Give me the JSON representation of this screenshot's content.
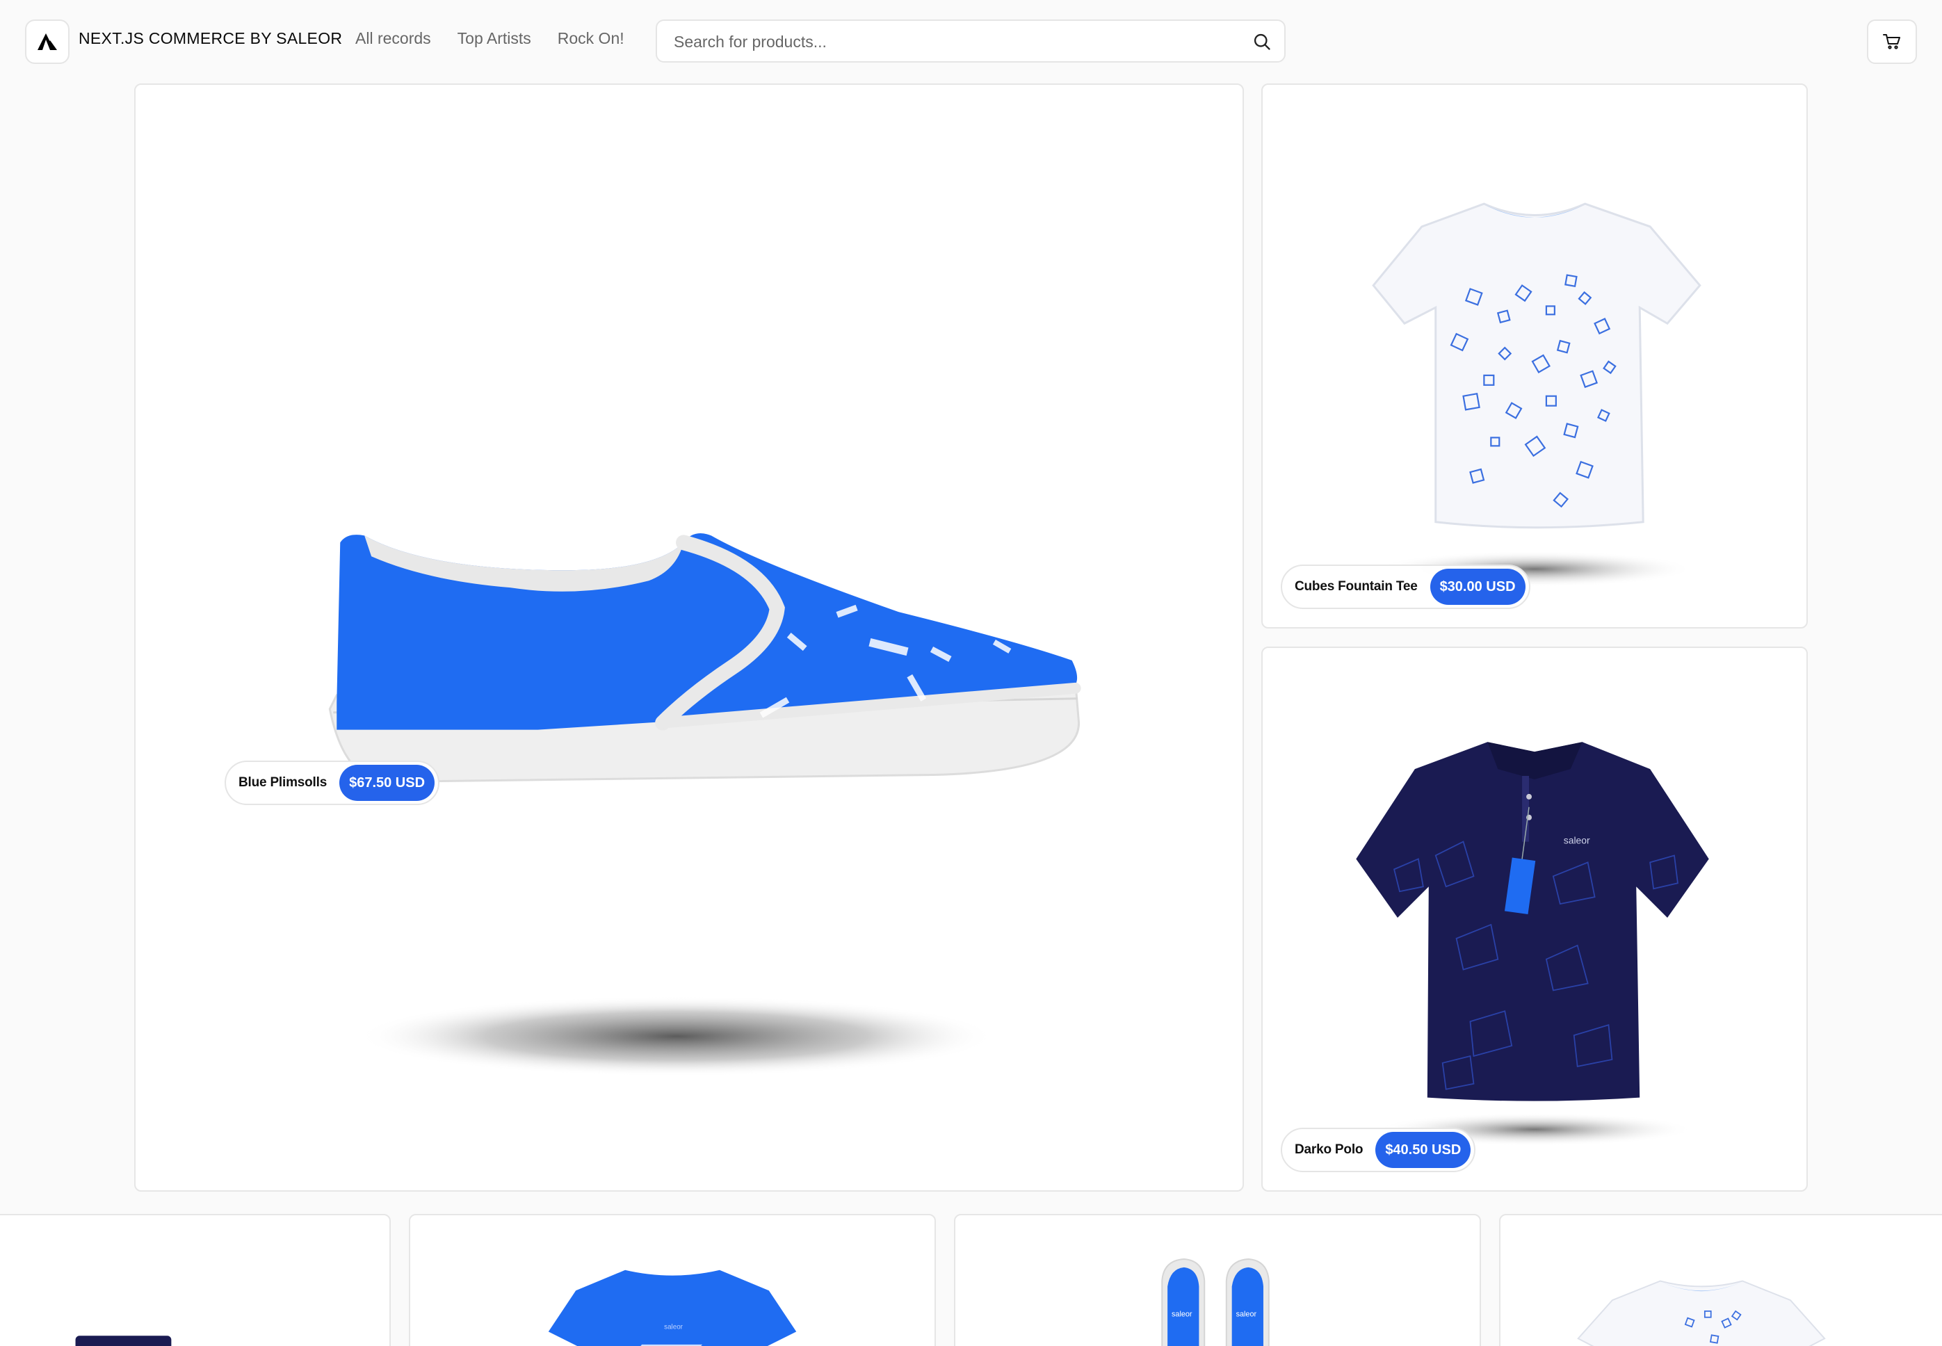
{
  "header": {
    "site_name": "NEXT.JS COMMERCE BY SALEOR",
    "nav": [
      "All records",
      "Top Artists",
      "Rock On!"
    ],
    "search_placeholder": "Search for products..."
  },
  "featured": [
    {
      "name": "Blue Plimsolls",
      "price": "$67.50 USD"
    },
    {
      "name": "Cubes Fountain Tee",
      "price": "$30.00 USD"
    },
    {
      "name": "Darko Polo",
      "price": "$40.50 USD"
    }
  ],
  "colors": {
    "accent": "#2563eb",
    "product_blue": "#1f6cf2",
    "polo_navy": "#1a1b52",
    "background": "#fafafa"
  },
  "icons": [
    "logo-triangle-icon",
    "search-icon",
    "cart-icon"
  ]
}
